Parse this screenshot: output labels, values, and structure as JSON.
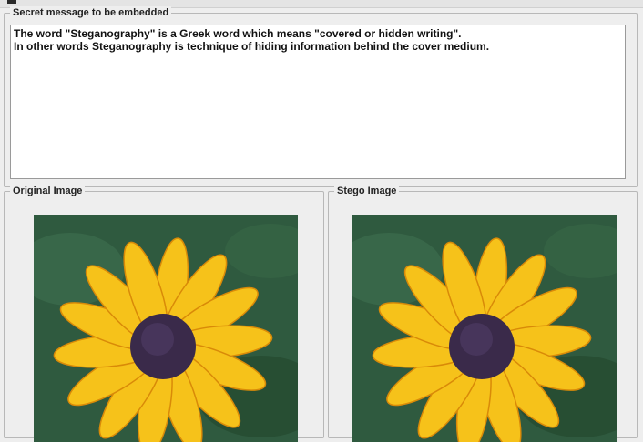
{
  "message_panel": {
    "title": "Secret message to be embedded",
    "lines": [
      "The word \"Steganography\" is a Greek word which means \"covered or hidden writing\".",
      "In other words Steganography is technique of hiding information behind the cover medium."
    ]
  },
  "original_panel": {
    "title": "Original Image",
    "image_icon": "yellow-flower-image"
  },
  "stego_panel": {
    "title": "Stego Image",
    "image_icon": "yellow-flower-image"
  },
  "colors": {
    "petal": "#f6c21a",
    "petal_edge": "#d98a08",
    "center": "#3a2a4a",
    "background_leaf": "#2f5a3f"
  }
}
